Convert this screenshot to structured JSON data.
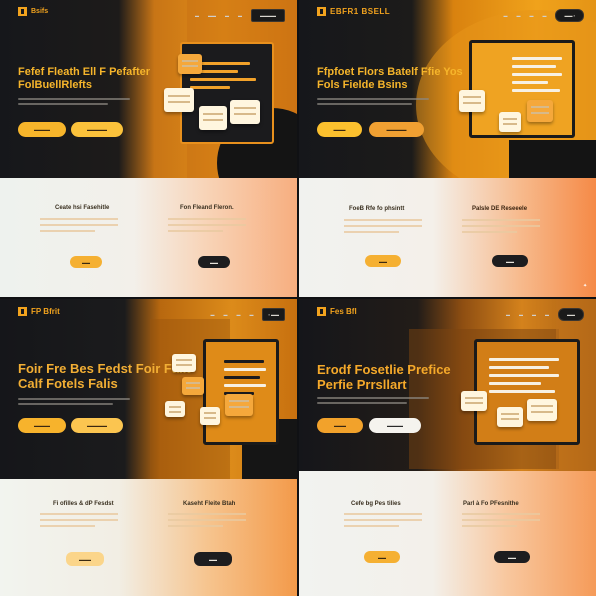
{
  "panels": [
    {
      "logo_text": "Bsifs",
      "nav": [
        "",
        "",
        "",
        "",
        ""
      ],
      "nav_button": "",
      "hero_title_1": "Fefef Fleath Ell F Pefafter",
      "hero_title_2": "FolBuellRlefts",
      "cta_primary": "",
      "cta_secondary": "",
      "feature_1_title": "Ceate hsi Fasehitle",
      "feature_2_title": "Fon Fleand Fleron.",
      "feature_1_button": "",
      "feature_2_button": ""
    },
    {
      "logo_text": "EBFR1 BSELL",
      "nav": [
        "",
        "",
        "",
        ""
      ],
      "nav_button": "",
      "hero_title_1": "Ffpfoet Flors Batelf Ffie Yos",
      "hero_title_2": "Fols Fielde Bsins",
      "cta_primary": "",
      "cta_secondary": "",
      "feature_1_title": "FoeB Rfe fo phsintt",
      "feature_2_title": "Palsle DE Reseeele",
      "feature_1_button": "",
      "feature_2_button": ""
    },
    {
      "logo_text": "FP Bfrit",
      "nav": [
        "",
        "",
        "",
        ""
      ],
      "nav_button": "",
      "hero_title_1": "Foir Fre Bes Fedst Foir Fallt",
      "hero_title_2": "Calf Fotels Falis",
      "cta_primary": "",
      "cta_secondary": "",
      "feature_1_title": "Fi ofilles & dP Fesdst",
      "feature_2_title": "Kaseht Fleite Btah",
      "feature_1_button": "",
      "feature_2_button": ""
    },
    {
      "logo_text": "Fes Bfl",
      "nav": [
        "",
        "",
        "",
        ""
      ],
      "nav_button": "",
      "hero_title_1": "Erodf Fosetlie Prefice",
      "hero_title_2": "Perfie Prrsllart",
      "cta_primary": "",
      "cta_secondary": "",
      "feature_1_title": "Cefe bg Pes tilies",
      "feature_2_title": "Parl à Fo PFesnithe",
      "feature_1_button": "",
      "feature_2_button": ""
    }
  ],
  "colors": {
    "accent": "#f5ac2a",
    "dark": "#16171b",
    "light": "#f2f3f0"
  }
}
